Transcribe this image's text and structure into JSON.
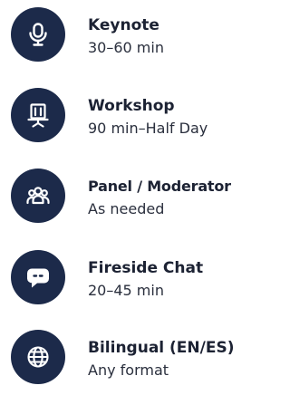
{
  "formats": [
    {
      "icon": "microphone-icon",
      "title": "Keynote",
      "duration": "30–60 min"
    },
    {
      "icon": "presentation-board-icon",
      "title": "Workshop",
      "duration": "90 min–Half Day"
    },
    {
      "icon": "group-icon",
      "title": "Panel / Moderator",
      "duration": "As needed"
    },
    {
      "icon": "chat-bubble-icon",
      "title": "Fireside Chat",
      "duration": "20–45 min"
    },
    {
      "icon": "globe-icon",
      "title": "Bilingual (EN/ES)",
      "duration": "Any format"
    }
  ],
  "colors": {
    "icon_background": "#1c2a4a",
    "icon_foreground": "#ffffff",
    "title_text": "#1c2233"
  }
}
